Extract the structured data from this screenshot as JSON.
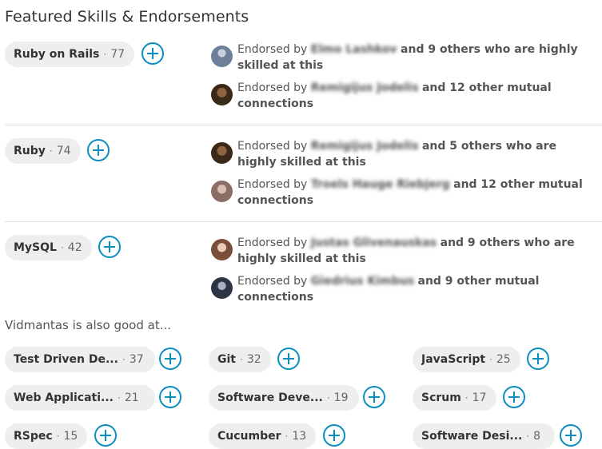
{
  "section_title": "Featured Skills & Endorsements",
  "featured": [
    {
      "name": "Ruby on Rails",
      "count": "77",
      "endorsements": [
        {
          "prefix": "Endorsed by",
          "who": "Elmo Lashkov",
          "suffix": "and 9 others who are highly skilled at this",
          "avatar_color": "#6e7f9a"
        },
        {
          "prefix": "Endorsed by",
          "who": "Remigijus Jodelis",
          "suffix": "and 12 other mutual connections",
          "avatar_color": "#6a4a2e"
        }
      ]
    },
    {
      "name": "Ruby",
      "count": "74",
      "endorsements": [
        {
          "prefix": "Endorsed by",
          "who": "Remigijus Jodelis",
          "suffix": "and 5 others who are highly skilled at this",
          "avatar_color": "#6a4a2e"
        },
        {
          "prefix": "Endorsed by",
          "who": "Troels Hauge Riebjerg",
          "suffix": "and 12 other mutual connections",
          "avatar_color": "#b89a8c"
        }
      ]
    },
    {
      "name": "MySQL",
      "count": "42",
      "endorsements": [
        {
          "prefix": "Endorsed by",
          "who": "Justas Glivenauskas",
          "suffix": "and 9 others who are highly skilled at this",
          "avatar_color": "#a87a62"
        },
        {
          "prefix": "Endorsed by",
          "who": "Giedrius Kimbus",
          "suffix": "and 9 other mutual connections",
          "avatar_color": "#4a5060"
        }
      ]
    }
  ],
  "also_good_at_label": "Vidmantas is also good at...",
  "other_skills": [
    {
      "name": "Test Driven De...",
      "count": "37"
    },
    {
      "name": "Git",
      "count": "32"
    },
    {
      "name": "JavaScript",
      "count": "25"
    },
    {
      "name": "Web Applicati...",
      "count": "21"
    },
    {
      "name": "Software Deve...",
      "count": "19"
    },
    {
      "name": "Scrum",
      "count": "17"
    },
    {
      "name": "RSpec",
      "count": "15"
    },
    {
      "name": "Cucumber",
      "count": "13"
    },
    {
      "name": "Software Desi...",
      "count": "8"
    }
  ],
  "colors": {
    "accent": "#0a8ec0",
    "pill_bg": "#eeeeee",
    "divider": "#e0e0e0"
  },
  "icons": {
    "endorse": "plus-icon"
  }
}
